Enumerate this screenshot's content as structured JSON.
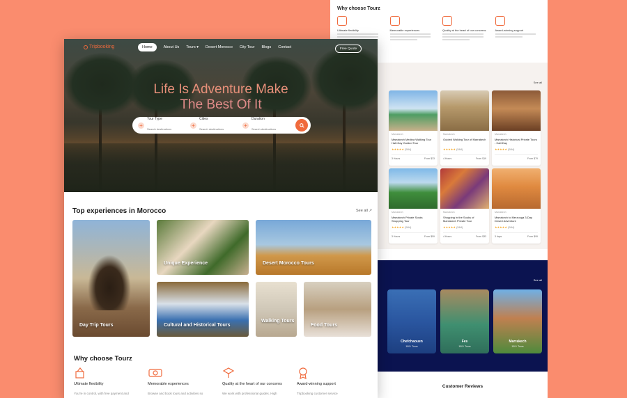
{
  "brand": {
    "logo_text": "Tripbooking",
    "accent": "#F06A3C",
    "page_bg": "#FA8C6E",
    "navy": "#0B1350"
  },
  "nav": {
    "items": [
      "Home",
      "About Us",
      "Tours",
      "Desert Morocco",
      "City Tour",
      "Blogs",
      "Contact"
    ],
    "active_index": 0,
    "quote_button": "Free Quote"
  },
  "hero": {
    "headline_line1": "Life Is Adventure Make",
    "headline_line2": "The Best Of It",
    "search": {
      "fields": [
        {
          "label": "Tour Type",
          "placeholder": "Search destinations"
        },
        {
          "label": "Cities",
          "placeholder": "Search destinations"
        },
        {
          "label": "Duration",
          "placeholder": "Search destinations"
        }
      ],
      "search_icon": "search-icon"
    }
  },
  "experiences": {
    "title": "Top experiences in Morocco",
    "see_all": "See all",
    "cards": [
      {
        "caption": "Day Trip Tours"
      },
      {
        "caption": "Unique Experience"
      },
      {
        "caption": "Desert Morocco Tours"
      },
      {
        "caption": "Cultural and Historical Tours"
      },
      {
        "caption": "Walking Tours"
      },
      {
        "caption": "Food Tours"
      }
    ]
  },
  "why": {
    "title": "Why choose Tourz",
    "items": [
      {
        "heading": "Ultimate flexibility",
        "text": "You're in control, with free payment and"
      },
      {
        "heading": "Memorable experiences",
        "text": "Browse and book tours and activities so"
      },
      {
        "heading": "Quality at the heart of our concerns",
        "text": "We work with professional guides. High"
      },
      {
        "heading": "Award-winning support",
        "text": "Tripbooking customer service"
      }
    ]
  },
  "back_page": {
    "why_title": "Why choose Tourz",
    "why_items": [
      {
        "heading": "Ultimate flexibility"
      },
      {
        "heading": "Memorable experiences"
      },
      {
        "heading": "Quality at the heart of our concerns"
      },
      {
        "heading": "Award-winning support"
      }
    ],
    "see_all": "See all",
    "tours": [
      {
        "title": "Marrakech Medina Walking Tour Half-Day Guided Tour",
        "location": "Marrakech",
        "reviews": "(584)",
        "duration": "3 Hours",
        "price": "From $33"
      },
      {
        "title": "Guided Walking Tour of Marrakech",
        "location": "Marrakech",
        "reviews": "(584)",
        "duration": "4 Hours",
        "price": "From $19"
      },
      {
        "title": "Marrakech Historical Private Tours - Half-Day",
        "location": "Marrakech",
        "reviews": "(584)",
        "duration": "",
        "price": "From $79"
      },
      {
        "title": "Marrakech Private Souks Shopping Tour",
        "location": "Marrakech",
        "reviews": "(584)",
        "duration": "3 Hours",
        "price": "From $59"
      },
      {
        "title": "Shopping in the Souks of Marrakech Private Tour",
        "location": "Marrakech",
        "reviews": "(584)",
        "duration": "4 Hours",
        "price": "From $33"
      },
      {
        "title": "Marrakech to Merzouga 3-Day Desert Adventure",
        "location": "Marrakech",
        "reviews": "(584)",
        "duration": "3 days",
        "price": "From $99"
      }
    ],
    "cities": [
      {
        "name": "Chefchaouen",
        "count": "100+ Tours"
      },
      {
        "name": "Fes",
        "count": "100+ Tours"
      },
      {
        "name": "Marrakech",
        "count": "100+ Tours"
      }
    ],
    "reviews_title": "Customer Reviews"
  }
}
